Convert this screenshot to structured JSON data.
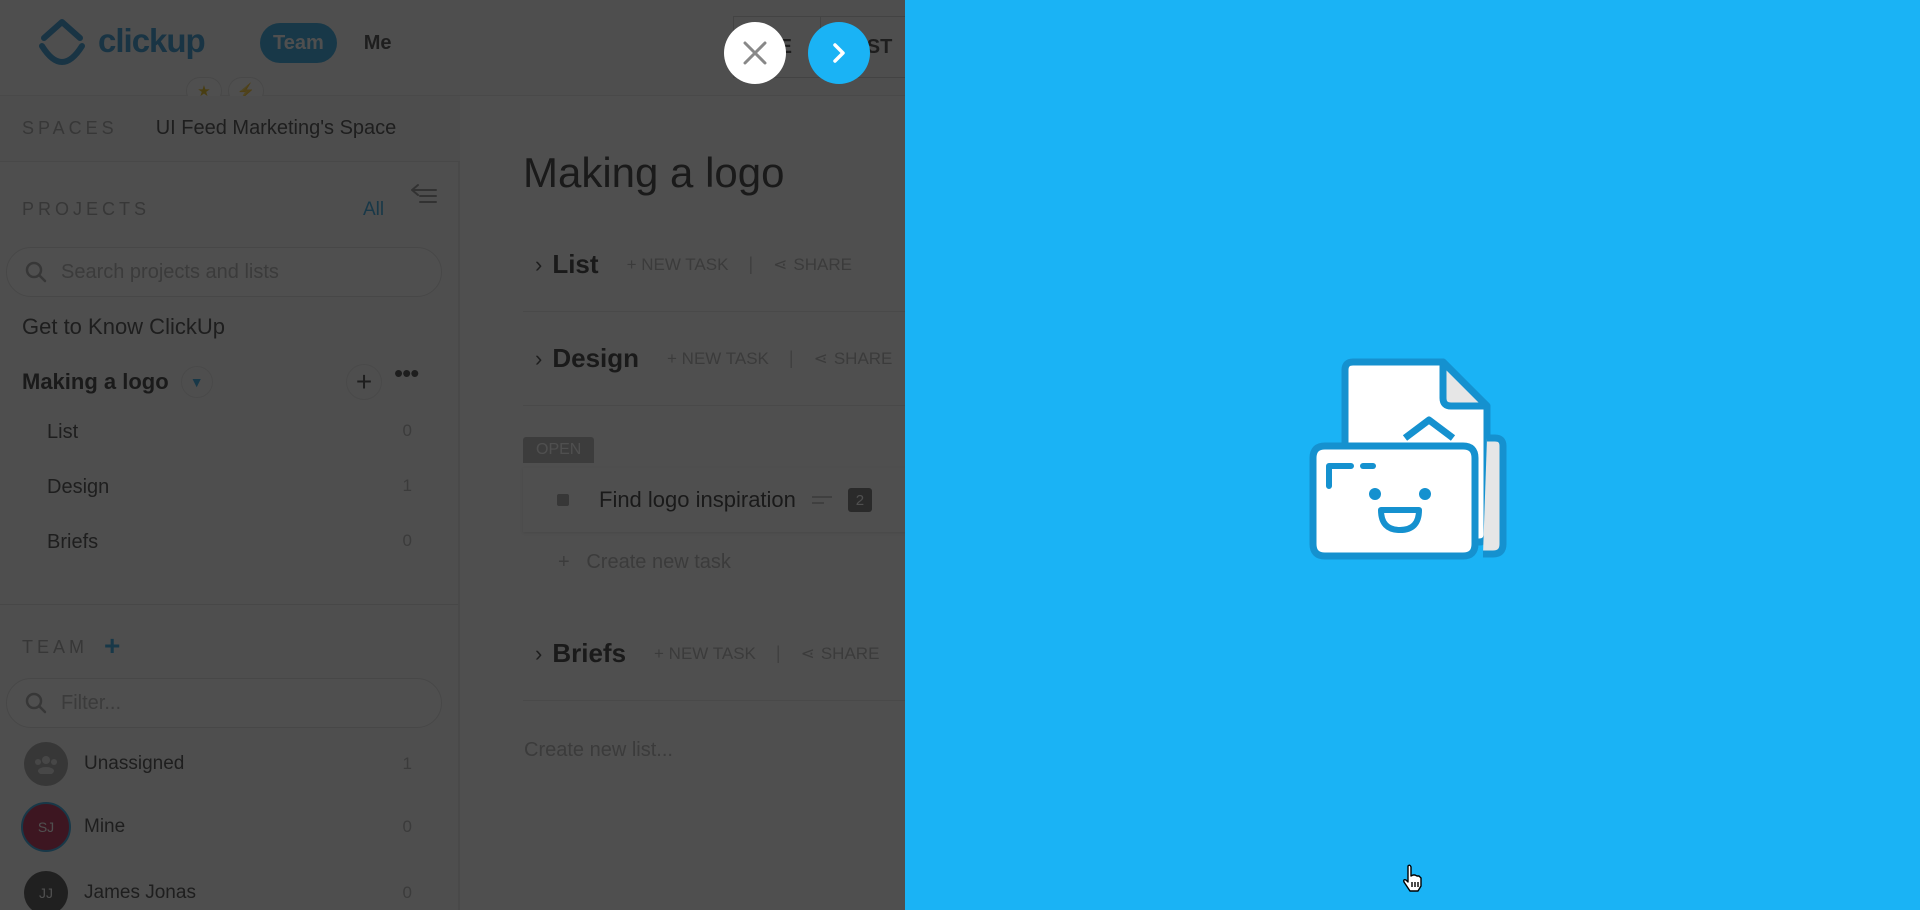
{
  "app": {
    "brand": "clickup",
    "scope_tabs": [
      "Team",
      "Me"
    ],
    "active_scope": "Team",
    "favorites": [
      "star-icon",
      "lightning-icon"
    ],
    "top_tabs": [
      "ME",
      "LIST"
    ]
  },
  "spaces": {
    "label": "SPACES",
    "current": "UI Feed Marketing's Space"
  },
  "sidebar": {
    "projects_label": "PROJECTS",
    "all_link": "All",
    "search_placeholder": "Search projects and lists",
    "projects": [
      {
        "name": "Get to Know ClickUp"
      }
    ],
    "active_project": {
      "name": "Making a logo",
      "lists": [
        {
          "name": "List",
          "count": "0"
        },
        {
          "name": "Design",
          "count": "1"
        },
        {
          "name": "Briefs",
          "count": "0"
        }
      ]
    },
    "team_label": "TEAM",
    "filter_placeholder": "Filter...",
    "members": [
      {
        "name": "Unassigned",
        "count": "1",
        "initials": "",
        "color": "#9a9a9a"
      },
      {
        "name": "Mine",
        "count": "0",
        "initials": "SJ",
        "color": "#b3123f"
      },
      {
        "name": "James Jonas",
        "count": "0",
        "initials": "JJ",
        "color": "#3a3a3a"
      }
    ]
  },
  "main": {
    "title": "Making a logo",
    "new_task_label": "+ NEW TASK",
    "share_label": "SHARE",
    "lists": [
      {
        "name": "List"
      },
      {
        "name": "Design"
      },
      {
        "name": "Briefs"
      }
    ],
    "status": "OPEN",
    "task": {
      "name": "Find logo inspiration",
      "badge": "2"
    },
    "create_task": "Create new task",
    "create_list": "Create new list..."
  },
  "onboarding": {
    "background_color": "#1ab3f5",
    "illustration": "smiling-folder-with-documents",
    "close_icon": "close-icon",
    "next_icon": "chevron-right-icon"
  }
}
